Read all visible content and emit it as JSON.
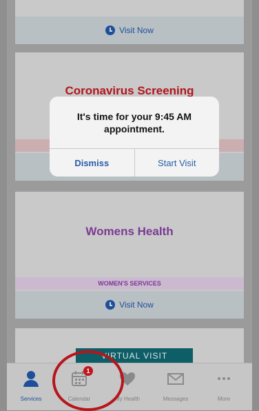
{
  "cards": {
    "top": {
      "visit_label": "Visit Now"
    },
    "coronavirus": {
      "title": "Coronavirus Screening"
    },
    "womens": {
      "title": "Womens Health",
      "band": "WOMEN'S SERVICES",
      "visit_label": "Visit Now"
    },
    "virtual": {
      "title": "VIRTUAL VISIT"
    }
  },
  "alert": {
    "message": "It's time for your 9:45 AM appointment.",
    "dismiss_label": "Dismiss",
    "start_label": "Start Visit"
  },
  "tabs": [
    {
      "label": "Services",
      "icon": "person-icon"
    },
    {
      "label": "Calendar",
      "icon": "calendar-icon",
      "badge": "1"
    },
    {
      "label": "My Health",
      "icon": "heart-icon"
    },
    {
      "label": "Messages",
      "icon": "envelope-icon"
    },
    {
      "label": "More",
      "icon": "more-icon"
    }
  ],
  "colors": {
    "accent": "#1d4f9b",
    "womens_purple": "#7b3a94",
    "alert_red": "#b2151c"
  }
}
